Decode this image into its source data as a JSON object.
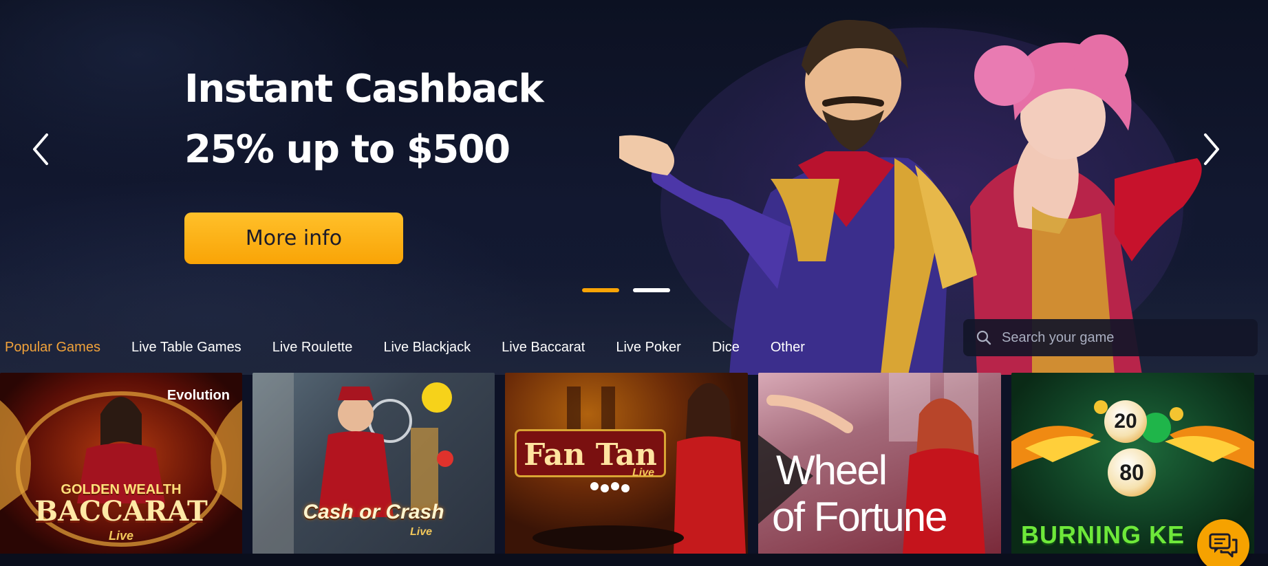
{
  "hero": {
    "title_line1": "Instant Cashback",
    "title_line2": "25% up to $500",
    "cta_label": "More info",
    "slides_count": 2,
    "active_slide": 1
  },
  "categories": [
    {
      "label": "Popular Games",
      "active": true
    },
    {
      "label": "Live Table Games",
      "active": false
    },
    {
      "label": "Live Roulette",
      "active": false
    },
    {
      "label": "Live Blackjack",
      "active": false
    },
    {
      "label": "Live Baccarat",
      "active": false
    },
    {
      "label": "Live Poker",
      "active": false
    },
    {
      "label": "Dice",
      "active": false
    },
    {
      "label": "Other",
      "active": false
    }
  ],
  "search": {
    "placeholder": "Search your game"
  },
  "games": [
    {
      "line1": "GOLDEN WEALTH",
      "line2": "BACCARAT",
      "tag": "Live",
      "provider": "Evolution"
    },
    {
      "line1": "Cash or Crash",
      "tag": "Live"
    },
    {
      "line1": "Fan Tan",
      "tag": "Live"
    },
    {
      "line1": "Wheel",
      "line2": "of Fortune"
    },
    {
      "line1": "BURNING KE",
      "ball1": "20",
      "ball2": "80"
    }
  ],
  "colors": {
    "accent": "#f9a406",
    "background": "#0d1226",
    "active_category": "#f2a33a"
  }
}
